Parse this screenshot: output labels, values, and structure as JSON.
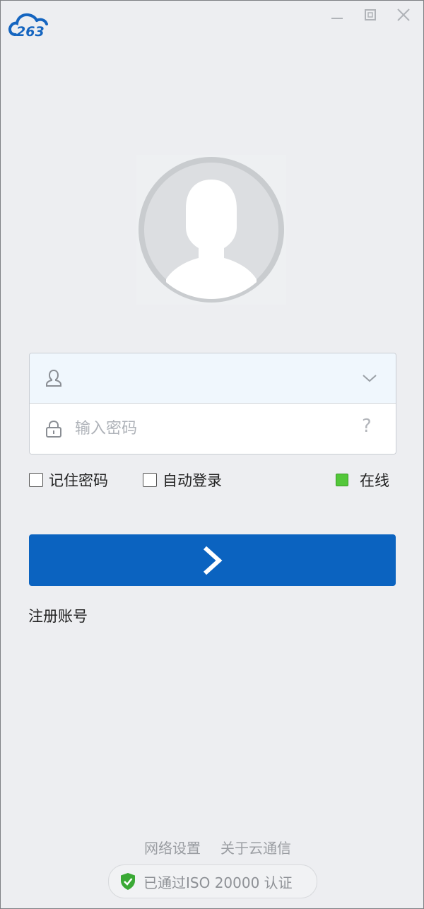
{
  "app": {
    "logo_icon": "cloud-263-logo",
    "brand_color": "#0b63c0"
  },
  "window_controls": {
    "minimize_icon": "minimize-icon",
    "maximize_icon": "maximize-icon",
    "close_icon": "close-icon"
  },
  "avatar": {
    "icon": "default-user-avatar-icon"
  },
  "login_form": {
    "username": {
      "value": "",
      "placeholder": "",
      "icon": "user-icon",
      "dropdown_icon": "chevron-down-icon"
    },
    "password": {
      "value": "",
      "placeholder": "输入密码",
      "icon": "lock-icon",
      "help_label": "?"
    }
  },
  "options": {
    "remember_password": {
      "label": "记住密码",
      "checked": false
    },
    "auto_login": {
      "label": "自动登录",
      "checked": false
    }
  },
  "status": {
    "label": "在线",
    "color": "#53c73a"
  },
  "login_button": {
    "icon": "chevron-right-icon"
  },
  "register_label": "注册账号",
  "footer": {
    "network_settings": "网络设置",
    "about": "关于云通信",
    "iso_badge": "已通过ISO 20000 认证",
    "iso_icon": "shield-check-icon",
    "iso_icon_color": "#3aa935"
  }
}
